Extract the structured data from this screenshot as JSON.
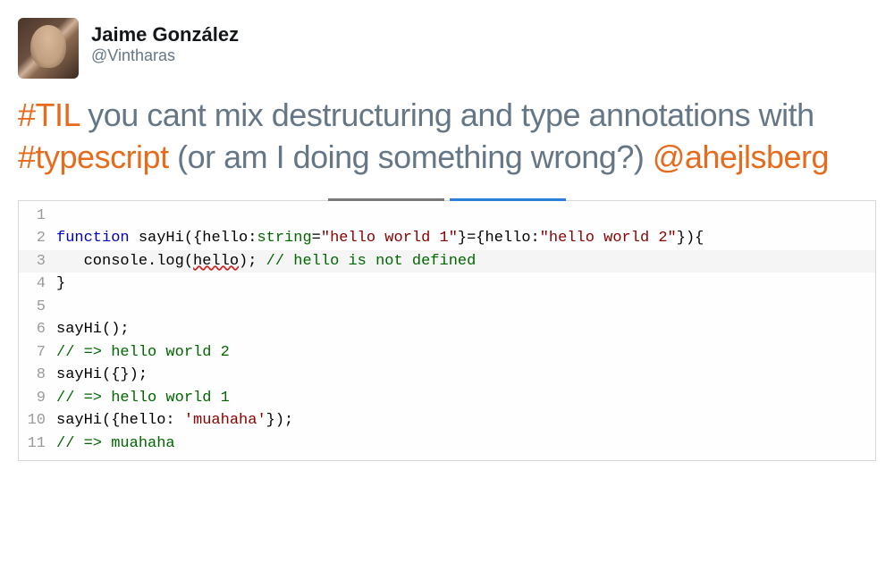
{
  "user": {
    "display_name": "Jaime González",
    "handle": "@Vintharas"
  },
  "tweet": {
    "parts": [
      {
        "type": "hashtag",
        "text": "#TIL"
      },
      {
        "type": "text",
        "text": " you cant mix destructuring and type annotations with "
      },
      {
        "type": "hashtag",
        "text": "#typescript"
      },
      {
        "type": "text",
        "text": " (or am I doing something wrong?) "
      },
      {
        "type": "mention",
        "text": "@ahejlsberg"
      }
    ]
  },
  "code": {
    "lines": [
      {
        "n": "1",
        "hl": false,
        "tokens": []
      },
      {
        "n": "2",
        "hl": false,
        "tokens": [
          {
            "t": "kw",
            "v": "function"
          },
          {
            "t": "",
            "v": " sayHi({hello:"
          },
          {
            "t": "type",
            "v": "string"
          },
          {
            "t": "",
            "v": "="
          },
          {
            "t": "str",
            "v": "\"hello world 1\""
          },
          {
            "t": "",
            "v": "}={hello:"
          },
          {
            "t": "str",
            "v": "\"hello world 2\""
          },
          {
            "t": "",
            "v": "}){"
          }
        ]
      },
      {
        "n": "3",
        "hl": true,
        "tokens": [
          {
            "t": "",
            "v": "   console.log("
          },
          {
            "t": "err",
            "v": "hello"
          },
          {
            "t": "",
            "v": "); "
          },
          {
            "t": "com",
            "v": "// hello is not defined"
          }
        ]
      },
      {
        "n": "4",
        "hl": false,
        "tokens": [
          {
            "t": "",
            "v": "}"
          }
        ]
      },
      {
        "n": "5",
        "hl": false,
        "tokens": []
      },
      {
        "n": "6",
        "hl": false,
        "tokens": [
          {
            "t": "",
            "v": "sayHi();"
          }
        ]
      },
      {
        "n": "7",
        "hl": false,
        "tokens": [
          {
            "t": "com",
            "v": "// => hello world 2"
          }
        ]
      },
      {
        "n": "8",
        "hl": false,
        "tokens": [
          {
            "t": "",
            "v": "sayHi({});"
          }
        ]
      },
      {
        "n": "9",
        "hl": false,
        "tokens": [
          {
            "t": "com",
            "v": "// => hello world 1"
          }
        ]
      },
      {
        "n": "10",
        "hl": false,
        "tokens": [
          {
            "t": "",
            "v": "sayHi({hello: "
          },
          {
            "t": "str",
            "v": "'muahaha'"
          },
          {
            "t": "",
            "v": "});"
          }
        ]
      },
      {
        "n": "11",
        "hl": false,
        "tokens": [
          {
            "t": "com",
            "v": "// => muahaha"
          }
        ]
      }
    ]
  }
}
